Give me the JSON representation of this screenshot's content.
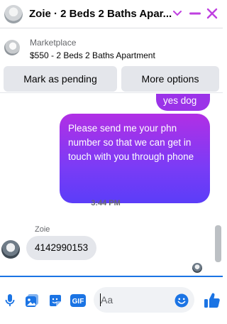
{
  "header": {
    "title": "Zoie · 2 Beds 2 Baths Apar...",
    "accent_color": "#bf3fe0"
  },
  "marketplace": {
    "source": "Marketplace",
    "item": "$550 - 2 Beds 2 Baths Apartment",
    "mark_pending_label": "Mark as pending",
    "more_options_label": "More options"
  },
  "messages": {
    "outgoing_partial": "yes dog",
    "outgoing_main": "Please send me your phn number so that we can get in touch with you through phone",
    "timestamp": "3:44 PM",
    "sender_name": "Zoie",
    "incoming_text": "4142990153"
  },
  "composer": {
    "placeholder": "Aa",
    "icons": [
      "microphone-icon",
      "photo-icon",
      "sticker-icon",
      "gif-icon",
      "emoji-icon",
      "like-icon"
    ],
    "gif_label": "GIF",
    "brand_color": "#1b74e4"
  }
}
